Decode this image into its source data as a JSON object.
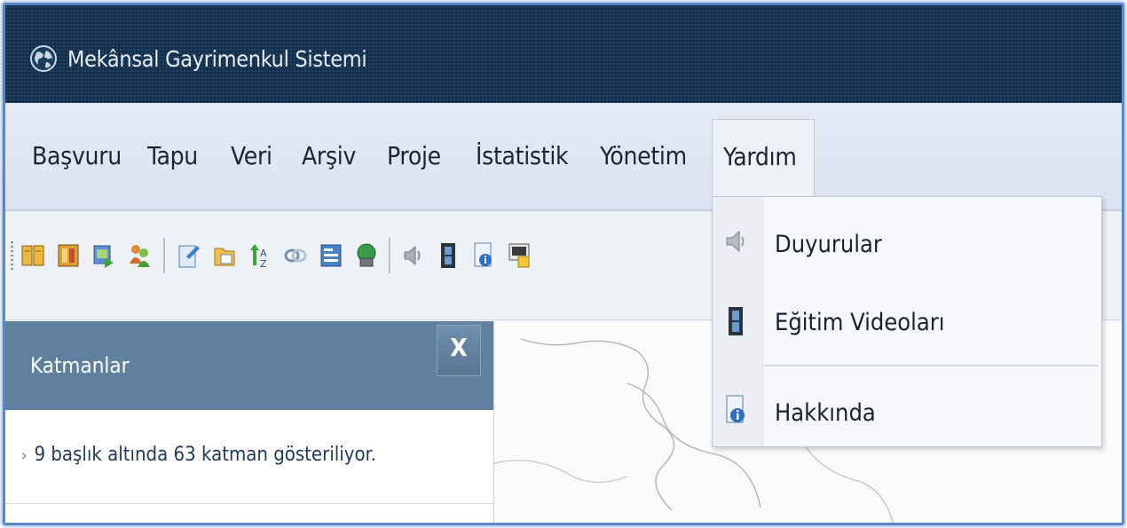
{
  "window": {
    "title": "Mekânsal Gayrimenkul Sistemi",
    "icon": "globe-icon"
  },
  "menubar": {
    "items": [
      {
        "label": "Başvuru"
      },
      {
        "label": "Tapu"
      },
      {
        "label": "Veri"
      },
      {
        "label": "Arşiv"
      },
      {
        "label": "Proje"
      },
      {
        "label": "İstatistik"
      },
      {
        "label": "Yönetim"
      },
      {
        "label": "Yardım",
        "open": true
      }
    ]
  },
  "toolbar": {
    "icons": [
      "book-icon",
      "ledger-icon",
      "image-export-icon",
      "users-icon",
      "document-edit-icon",
      "folder-layers-icon",
      "sort-icon",
      "link-icon",
      "form-icon",
      "globe-print-icon",
      "speaker-icon",
      "film-icon",
      "info-document-icon",
      "certificate-icon"
    ]
  },
  "dropdown": {
    "items": [
      {
        "label": "Duyurular",
        "icon": "speaker-icon"
      },
      {
        "label": "Eğitim Videoları",
        "icon": "film-icon"
      },
      {
        "label": "Hakkında",
        "icon": "info-document-icon"
      }
    ]
  },
  "layers_panel": {
    "title": "Katmanlar",
    "close_label": "X",
    "info": "9 başlık altında 63 katman gösteriliyor."
  },
  "colors": {
    "titlebar": "#13314f",
    "menubar": "#dbe3f0",
    "panel_header": "#60809f",
    "frame_border": "#5b86c7"
  }
}
